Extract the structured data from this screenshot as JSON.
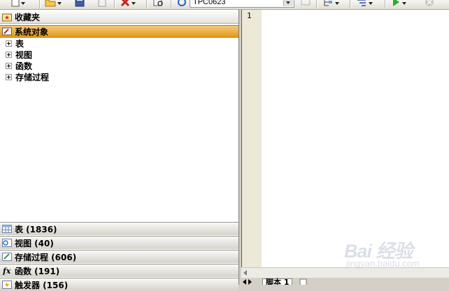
{
  "toolbar": {
    "database_selector": "TPC0623",
    "icons": [
      "new-icon",
      "open-folder-icon",
      "save-icon",
      "image-icon",
      "delete-icon",
      "find-icon",
      "refresh-icon",
      "disconnect-icon",
      "tree-icon",
      "sort-icon",
      "run-icon",
      "stop-icon"
    ]
  },
  "left_panel": {
    "favorites_header": "收藏夹",
    "system_objects_header": "系统对象",
    "tree_items": [
      "表",
      "视图",
      "函数",
      "存储过程"
    ],
    "categories": [
      {
        "label": "表 (1836)",
        "icon": "table-icon"
      },
      {
        "label": "视图 (40)",
        "icon": "view-icon"
      },
      {
        "label": "存储过程 (606)",
        "icon": "procedure-icon"
      },
      {
        "label": "函数 (191)",
        "icon": "function-icon"
      },
      {
        "label": "触发器 (156)",
        "icon": "trigger-icon"
      }
    ]
  },
  "editor": {
    "line_numbers": [
      "1"
    ],
    "tabs": [
      {
        "label": "脚本 1"
      }
    ]
  },
  "watermark": {
    "brand": "Bai 经验",
    "url": "jingyan.baidu.com"
  },
  "colors": {
    "selected_header": "#e8a838",
    "gutter": "#ece9d8",
    "panel_bg": "#ffffff"
  }
}
